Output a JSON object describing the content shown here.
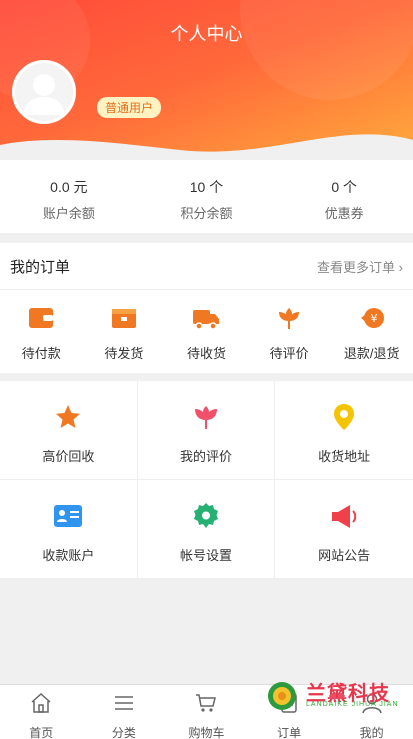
{
  "header": {
    "title": "个人中心",
    "user_badge": "普通用户",
    "colors": {
      "gradient_start": "#ff5a3c",
      "gradient_end": "#ffa03a"
    }
  },
  "stats": [
    {
      "value": "0.0 元",
      "label": "账户余额"
    },
    {
      "value": "10 个",
      "label": "积分余额"
    },
    {
      "value": "0 个",
      "label": "优惠券"
    }
  ],
  "orders": {
    "title": "我的订单",
    "more_label": "查看更多订单",
    "items": [
      {
        "label": "待付款",
        "icon": "wallet-icon"
      },
      {
        "label": "待发货",
        "icon": "package-icon"
      },
      {
        "label": "待收货",
        "icon": "truck-icon"
      },
      {
        "label": "待评价",
        "icon": "flower-icon"
      },
      {
        "label": "退款/退货",
        "icon": "refund-icon"
      }
    ]
  },
  "services": [
    {
      "label": "高价回收",
      "icon": "star-icon"
    },
    {
      "label": "我的评价",
      "icon": "tulip-icon"
    },
    {
      "label": "收货地址",
      "icon": "location-pin-icon"
    },
    {
      "label": "收款账户",
      "icon": "id-card-icon"
    },
    {
      "label": "帐号设置",
      "icon": "gear-icon"
    },
    {
      "label": "网站公告",
      "icon": "megaphone-icon"
    }
  ],
  "tabbar": [
    {
      "label": "首页",
      "icon": "home-icon"
    },
    {
      "label": "分类",
      "icon": "list-icon"
    },
    {
      "label": "购物车",
      "icon": "cart-icon"
    },
    {
      "label": "订单",
      "icon": "order-icon"
    },
    {
      "label": "我的",
      "icon": "user-icon"
    }
  ],
  "watermark": {
    "title": "兰黛科技",
    "subtitle": "LANDAIKE JIHUA JIAN"
  }
}
